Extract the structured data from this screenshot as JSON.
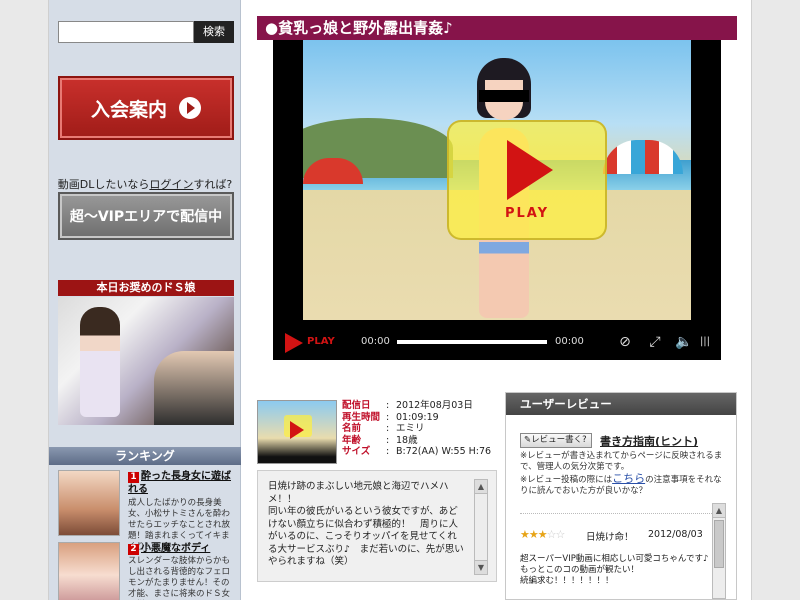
{
  "sidebar": {
    "search_placeholder": "",
    "search_button": "検索",
    "join_button": "入会案内",
    "download_prefix": "動画DLしたいなら",
    "download_login": "ログイン",
    "download_suffix": "すれば?",
    "vip_button": "超～VIPエリアで配信中",
    "recommend_heading": "本日お奨めのドＳ娘",
    "ranking_heading": "ランキング",
    "ranking": [
      {
        "rank": "1",
        "title": "酔った長身女に遊ばれる",
        "desc": "成人したばかりの長身美女、小松サトミさんを酔わせたらエッチなことされ放題！踏まれまくってイキまくり！"
      },
      {
        "rank": "2",
        "title": "小悪魔なボディ",
        "desc": "スレンダーな肢体からかもし出される背徳的なフェロモンがたまりません！その才能、まさに将来のドＳ女王様！"
      }
    ]
  },
  "main": {
    "title": "●貧乳っ娘と野外露出青姦♪",
    "player": {
      "overlay_label": "PLAY",
      "play_label": "PLAY",
      "time_current": "00:00",
      "time_total": "00:00"
    },
    "info": [
      {
        "key": "配信日",
        "value": "2012年08月03日"
      },
      {
        "key": "再生時間",
        "value": "01:09:19"
      },
      {
        "key": "名前",
        "value": "エミリ"
      },
      {
        "key": "年齢",
        "value": "18歳"
      },
      {
        "key": "サイズ",
        "value": "B:72(AA) W:55 H:76"
      }
    ],
    "description": "日焼け跡のまぶしい地元娘と海辺でハメハメ！！\n同い年の彼氏がいるという彼女ですが、あどけない顔立ちに似合わず積極的！　周りに人がいるのに、こっそりオッパイを見せてくれる大サービスぶり♪　まだ若いのに、先が思いやられますね（笑）"
  },
  "review": {
    "heading": "ユーザーレビュー",
    "write_button": "レビュー書く?",
    "guide_link": "書き方指南(ヒント)",
    "note_line1": "※レビューが書き込まれてからページに反映されるまで、管理人の気分次第です。",
    "note_line2_prefix": "※レビュー投稿の際には",
    "note_link": "こちら",
    "note_line2_suffix": "の注意事項をそれなりに読んでおいた方が良いかな？",
    "entry": {
      "rating": 3,
      "stars_on": "★★★",
      "stars_off": "☆☆",
      "title": "日焼け命！",
      "date": "2012/08/03",
      "text": "超スーパーVIP動画に相応しい可愛コちゃんです♪\nもっとこのコの動画が観たい！\n続編求む！！！！！！！"
    }
  }
}
